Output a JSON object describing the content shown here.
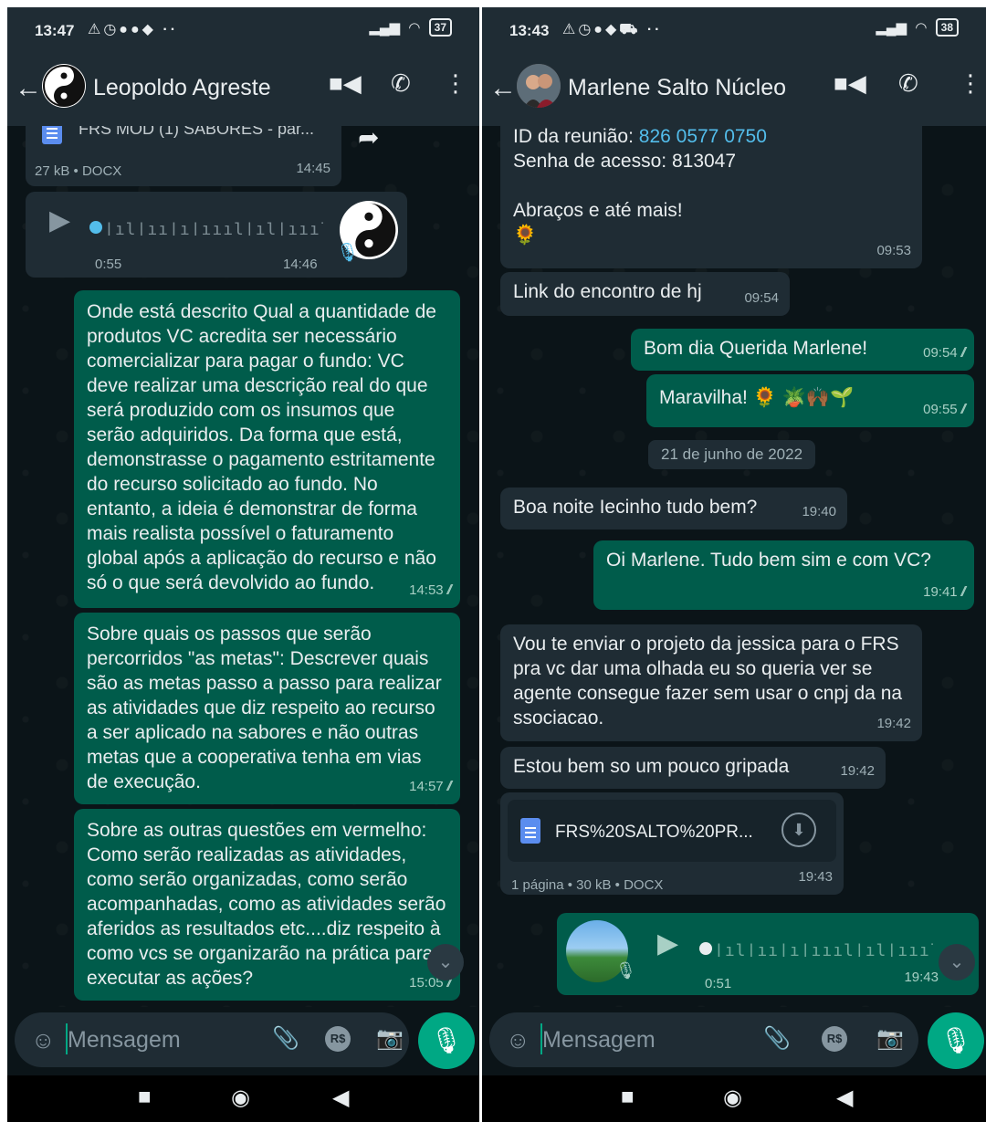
{
  "left": {
    "status": {
      "time": "13:47",
      "battery": "37"
    },
    "header": {
      "contact": "Leopoldo Agreste"
    },
    "doc": {
      "name": "FRS MOD (1) SABORES - par...",
      "meta": "27 kB • DOCX",
      "time": "14:45"
    },
    "audio": {
      "duration": "0:55",
      "time": "14:46"
    },
    "messages": [
      {
        "text": "Onde está descrito Qual a quantidade de produtos VC acredita ser necessário comercializar para pagar o fundo: VC deve realizar uma descrição real do que será produzido com os insumos que serão adquiridos. Da forma que está, demonstrasse o pagamento estritamente do recurso solicitado ao fundo. No entanto, a ideia é demonstrar de forma mais realista possível o faturamento global após a aplicação do recurso e não só o que será devolvido ao fundo.",
        "time": "14:53"
      },
      {
        "text": "Sobre quais os passos que serão percorridos \"as metas\": Descrever quais são as metas passo a passo para realizar as atividades que diz respeito ao recurso a ser aplicado na sabores e não outras metas que a cooperativa tenha em vias de execução.",
        "time": "14:57"
      },
      {
        "text": "Sobre as outras questões em vermelho: Como serão realizadas as atividades, como serão organizadas, como serão acompanhadas, como as atividades serão aferidos as resultados etc....diz respeito à como vcs se organizarão na prática para executar as ações?",
        "time": "15:05"
      }
    ],
    "input_placeholder": "Mensagem",
    "rs_label": "R$"
  },
  "right": {
    "status": {
      "time": "13:43",
      "battery": "38"
    },
    "header": {
      "contact": "Marlene Salto Núcleo"
    },
    "meeting": {
      "id_label": "ID da reunião: ",
      "id_value": "826 0577 0750",
      "pass": "Senha de acesso: 813047",
      "bye": "Abraços e até mais!",
      "emoji": "🌻",
      "time": "09:53"
    },
    "messages": [
      {
        "dir": "in",
        "text": "Link do encontro de hj",
        "time": "09:54"
      },
      {
        "dir": "out",
        "text": "Bom dia Querida Marlene!",
        "time": "09:54"
      },
      {
        "dir": "out",
        "text": "Maravilha! 🌻 🪴🙌🏾🌱",
        "time": "09:55"
      },
      {
        "dir": "in",
        "text": "Boa noite Iecinho tudo bem?",
        "time": "19:40"
      },
      {
        "dir": "out",
        "text": "Oi Marlene. Tudo bem sim e com VC?",
        "time": "19:41"
      },
      {
        "dir": "in",
        "text": "Vou te enviar o projeto da jessica para o FRS pra vc dar uma olhada eu so queria ver se agente consegue fazer sem usar o cnpj da na ssociacao.",
        "time": "19:42"
      },
      {
        "dir": "in",
        "text": "Estou bem so um pouco gripada",
        "time": "19:42"
      }
    ],
    "date_chip": "21 de junho de 2022",
    "doc": {
      "name": "FRS%20SALTO%20PR...",
      "meta": "1 página • 30 kB • DOCX",
      "time": "19:43"
    },
    "audio": {
      "duration": "0:51",
      "time": "19:43"
    },
    "input_placeholder": "Mensagem",
    "rs_label": "R$"
  },
  "colors": {
    "incoming": "#1f2c34",
    "outgoing": "#005c4b",
    "accent": "#00a884",
    "link": "#53bdeb"
  }
}
